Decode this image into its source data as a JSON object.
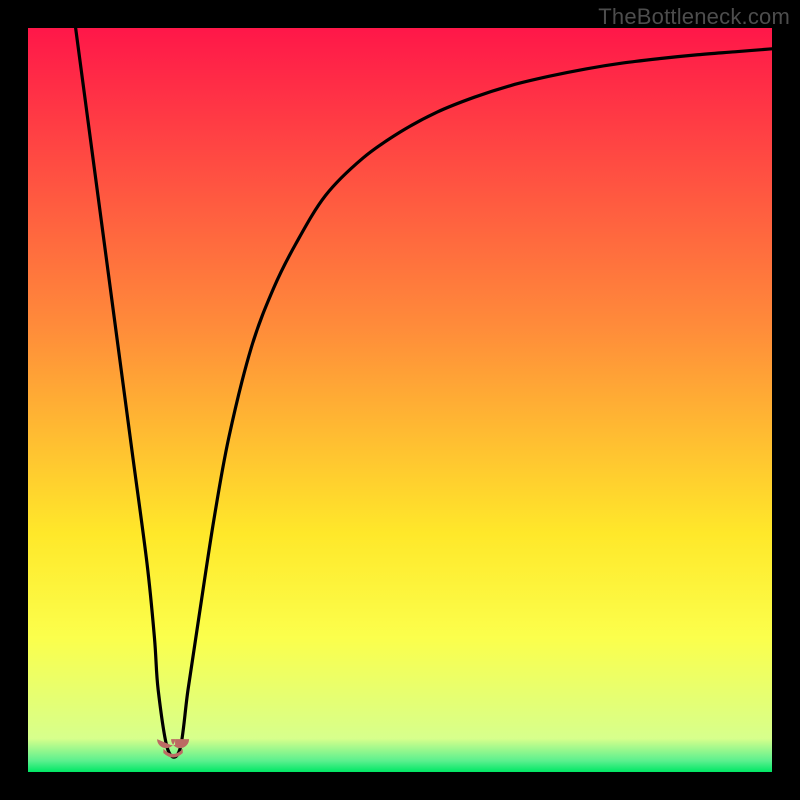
{
  "watermark": "TheBottleneck.com",
  "chart_data": {
    "type": "line",
    "title": "",
    "xlabel": "",
    "ylabel": "",
    "xlim": [
      0,
      100
    ],
    "ylim": [
      0,
      100
    ],
    "axes_visible": false,
    "grid": false,
    "gradient_stops": [
      {
        "offset": 0.0,
        "color": "#ff1749"
      },
      {
        "offset": 0.4,
        "color": "#ff8b3a"
      },
      {
        "offset": 0.68,
        "color": "#ffe82a"
      },
      {
        "offset": 0.82,
        "color": "#fbff4c"
      },
      {
        "offset": 0.955,
        "color": "#d7ff8c"
      },
      {
        "offset": 0.985,
        "color": "#5bf08e"
      },
      {
        "offset": 1.0,
        "color": "#00e765"
      }
    ],
    "series": [
      {
        "name": "bottleneck-curve",
        "x": [
          6.4,
          8.0,
          10.0,
          12.0,
          14.0,
          16.0,
          17.0,
          17.5,
          18.8,
          20.4,
          21.5,
          23.0,
          25.0,
          27.0,
          30.0,
          33.0,
          36.0,
          40.0,
          45.0,
          50.0,
          55.0,
          60.0,
          65.0,
          70.0,
          75.0,
          80.0,
          85.0,
          90.0,
          95.0,
          100.0
        ],
        "y": [
          100.0,
          88.0,
          73.0,
          58.0,
          43.0,
          28.0,
          18.0,
          11.0,
          3.0,
          3.0,
          11.0,
          21.0,
          34.0,
          45.0,
          57.0,
          65.0,
          71.0,
          77.5,
          82.5,
          86.0,
          88.7,
          90.7,
          92.3,
          93.5,
          94.5,
          95.3,
          95.9,
          96.4,
          96.8,
          97.2
        ]
      }
    ],
    "marker": {
      "x": 19.5,
      "y": 2.8,
      "color": "#bc6a63"
    }
  }
}
